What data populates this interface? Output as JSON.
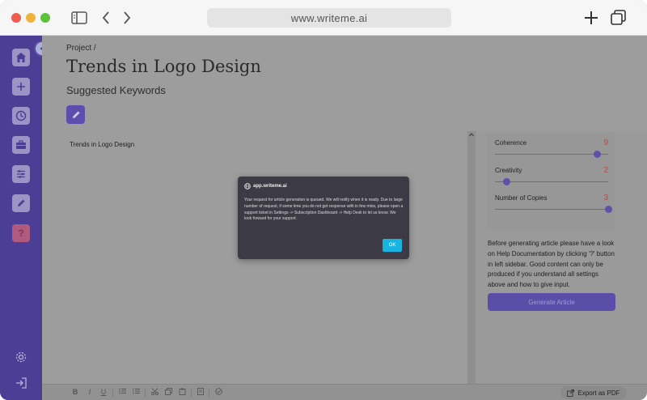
{
  "browser": {
    "url": "www.writeme.ai",
    "icons": {
      "sidebar_toggle": "sidebar-icon",
      "back": "chevron-left-icon",
      "forward": "chevron-right-icon",
      "new_tab": "plus-icon",
      "tabs": "tabs-icon"
    }
  },
  "sidebar": {
    "items": [
      {
        "name": "home",
        "icon": "home-icon"
      },
      {
        "name": "new",
        "icon": "plus-icon"
      },
      {
        "name": "history",
        "icon": "clock-icon"
      },
      {
        "name": "projects",
        "icon": "briefcase-icon"
      },
      {
        "name": "settings",
        "icon": "sliders-icon"
      },
      {
        "name": "editor",
        "icon": "pencil-icon"
      },
      {
        "name": "help",
        "icon": "question-icon",
        "label": "?"
      }
    ],
    "bottom": [
      {
        "name": "settings",
        "icon": "gear-icon"
      },
      {
        "name": "logout",
        "icon": "logout-icon"
      }
    ]
  },
  "page": {
    "breadcrumb": "Project /",
    "title": "Trends in Logo Design",
    "section_label": "Suggested Keywords"
  },
  "editor": {
    "content": "Trends in Logo Design"
  },
  "params": [
    {
      "label": "Coherence",
      "value": "9",
      "level": 0.9
    },
    {
      "label": "Creativity",
      "value": "2",
      "level": 0.1
    },
    {
      "label": "Number of Copies",
      "value": "3",
      "level": 1.0
    }
  ],
  "help_text": "Before generating article please have a look on Help Documentation by clicking '?' button in left sidebar. Good content can only be produced if you understand all settings above and how to give input.",
  "generate_label": "Generate Article",
  "toolbar": {
    "bold": "B",
    "italic": "I",
    "underline": "U",
    "export_label": "Export as PDF"
  },
  "modal": {
    "origin": "app.writeme.ai",
    "message": "Your request for article generation is queued. We will notify when it is ready. Due to large number of request, if some time you do not get response with in few mins, please open a support ticket in Settings -> Subscription Dashboard -> Help Desk to let us know. We look forward for your support.",
    "ok_label": "OK"
  },
  "colors": {
    "sidebar": "#4c3e94",
    "accent": "#5a4ea8",
    "ok_button": "#17b4e0",
    "param_value": "#b24a4a"
  }
}
